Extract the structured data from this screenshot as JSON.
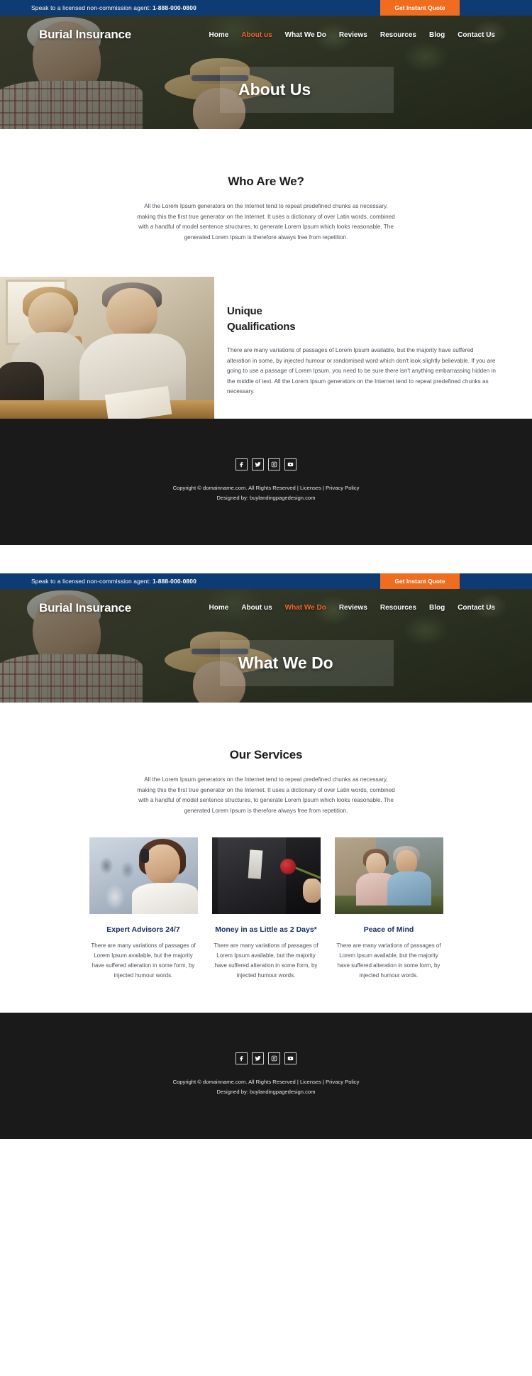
{
  "topbar": {
    "message_prefix": "Speak to a licensed non-commission agent:",
    "phone": "1-888-000-0800",
    "cta_label": "Get Instant Quote",
    "bg_color": "#0d3b73",
    "cta_color": "#f06c1e"
  },
  "brand": "Burial Insurance",
  "nav": {
    "items": [
      {
        "label": "Home",
        "active": false
      },
      {
        "label": "About us",
        "active": false
      },
      {
        "label": "What We Do",
        "active": false
      },
      {
        "label": "Reviews",
        "active": false
      },
      {
        "label": "Resources",
        "active": false
      },
      {
        "label": "Blog",
        "active": false
      },
      {
        "label": "Contact Us",
        "active": false
      }
    ],
    "active_color": "#f2692a"
  },
  "page_one": {
    "hero_title": "About Us",
    "active_nav": "About us",
    "who_are_we": {
      "title": "Who Are We?",
      "paragraph": "All the Lorem Ipsum generators on the Internet tend to repeat predefined chunks as necessary, making this the first true generator on the Internet. It uses a dictionary of over Latin words, combined with a handful of model sentence structures, to generate Lorem Ipsum which looks reasonable. The generated Lorem Ipsum is therefore always free from repetition."
    },
    "unique": {
      "title_line1": "Unique",
      "title_line2": "Qualifications",
      "paragraph": "There are many variations of passages of Lorem Ipsum available, but the majority have suffered alteration in some, by injected humour or randomised word which don't look slightly believable. If you are going to use a passage of Lorem Ipsum, you need to be sure there isn't anything embarrassing hidden in the middle of text. All the Lorem Ipsum generators on the Internet tend to repeat predefined chunks as necessary."
    }
  },
  "page_two": {
    "hero_title": "What We Do",
    "active_nav": "What We Do",
    "services": {
      "title": "Our Services",
      "paragraph": "All the Lorem Ipsum generators on the Internet tend to repeat predefined chunks as necessary, making this the first true generator on the Internet. It uses a dictionary of over Latin words, combined with a handful of model sentence structures, to generate Lorem Ipsum which looks reasonable. The generated Lorem Ipsum is therefore always free from repetition.",
      "cards": [
        {
          "title": "Expert Advisors 24/7",
          "desc": "There are many variations of passages of Lorem Ipsum available, but the majority have suffered alteration in some form, by injected humour words.",
          "image_name": "call-center-agent-photo"
        },
        {
          "title": "Money in as Little as 2 Days*",
          "desc": "There are many variations of passages of Lorem Ipsum available, but the majority have suffered alteration in some form, by injected humour words.",
          "image_name": "man-with-rose-photo"
        },
        {
          "title": "Peace of Mind",
          "desc": "There are many variations of passages of Lorem Ipsum available, but the majority have suffered alteration in some form, by injected humour words.",
          "image_name": "senior-couple-photo"
        }
      ],
      "title_color": "#132d5e"
    }
  },
  "footer": {
    "social": [
      {
        "name": "facebook-icon",
        "label": "Facebook"
      },
      {
        "name": "twitter-icon",
        "label": "Twitter"
      },
      {
        "name": "instagram-icon",
        "label": "Instagram"
      },
      {
        "name": "youtube-icon",
        "label": "YouTube"
      }
    ],
    "copyright": "Copyright © domainname.com. All Rights Reserved  |  Licenses  |  Privacy Policy",
    "designed_by": "Designed by: buylandingpagedesign.com",
    "bg_color": "#1a1a1a"
  }
}
